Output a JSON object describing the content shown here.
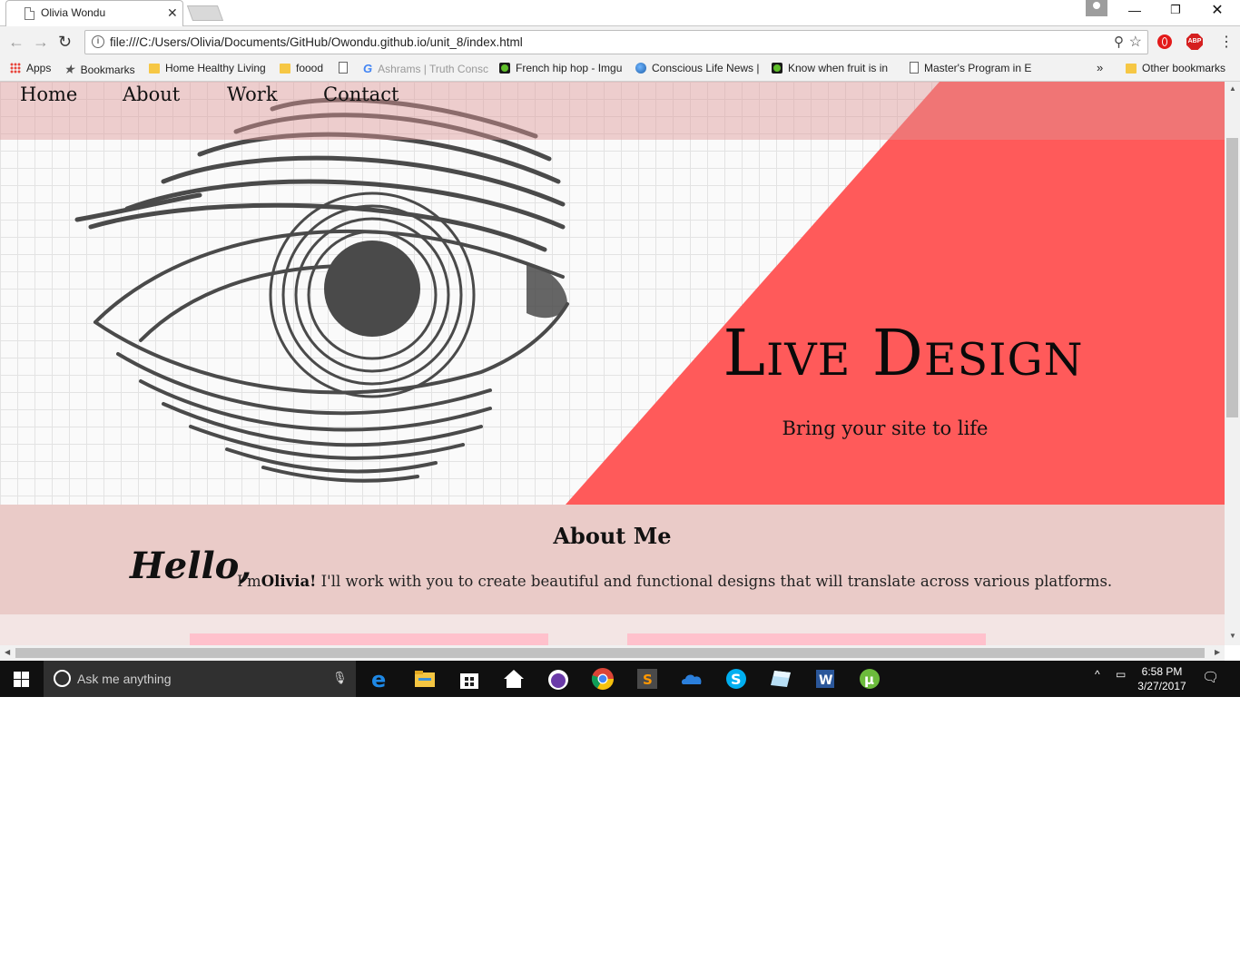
{
  "browser": {
    "tab_title": "Olivia Wondu",
    "url": "file:///C:/Users/Olivia/Documents/GitHub/Owondu.github.io/unit_8/index.html",
    "bookmarks": [
      {
        "label": "Apps",
        "icon": "apps-icon"
      },
      {
        "label": "Bookmarks",
        "icon": "star-icon"
      },
      {
        "label": "Home Healthy Living",
        "icon": "folder-icon"
      },
      {
        "label": "foood",
        "icon": "folder-icon"
      },
      {
        "label": "",
        "icon": "page-icon"
      },
      {
        "label": "Ashrams | Truth Consc",
        "icon": "google-icon"
      },
      {
        "label": "French hip hop - Imgu",
        "icon": "green-dot-icon"
      },
      {
        "label": "Conscious Life News |",
        "icon": "globe-icon"
      },
      {
        "label": "Know when fruit is in",
        "icon": "green-dot-icon"
      },
      {
        "label": "Master's Program in E",
        "icon": "page-icon"
      }
    ],
    "overflow_label": "»",
    "other_bookmarks": "Other bookmarks"
  },
  "page": {
    "nav": [
      "Home",
      "About",
      "Work",
      "Contact"
    ],
    "hero_title": "Live Design",
    "hero_subtitle": "Bring your site to life",
    "about_title": "About Me",
    "hello": "Hello,",
    "about_prefix": "I'm",
    "about_name": "Olivia!",
    "about_rest": " I'll work with you to create beautiful and functional designs that will translate across various platforms.",
    "colors": {
      "accent": "#ff5a5a",
      "about_bg": "#eacbc8",
      "card": "#ffc1cc"
    }
  },
  "taskbar": {
    "search_placeholder": "Ask me anything",
    "time": "6:58 PM",
    "date": "3/27/2017",
    "apps": [
      "edge-icon",
      "file-explorer-icon",
      "store-icon",
      "home-icon",
      "cat-app-icon",
      "chrome-icon",
      "sublime-icon",
      "onedrive-icon",
      "skype-icon",
      "glass-app-icon",
      "word-icon",
      "utorrent-icon"
    ]
  }
}
